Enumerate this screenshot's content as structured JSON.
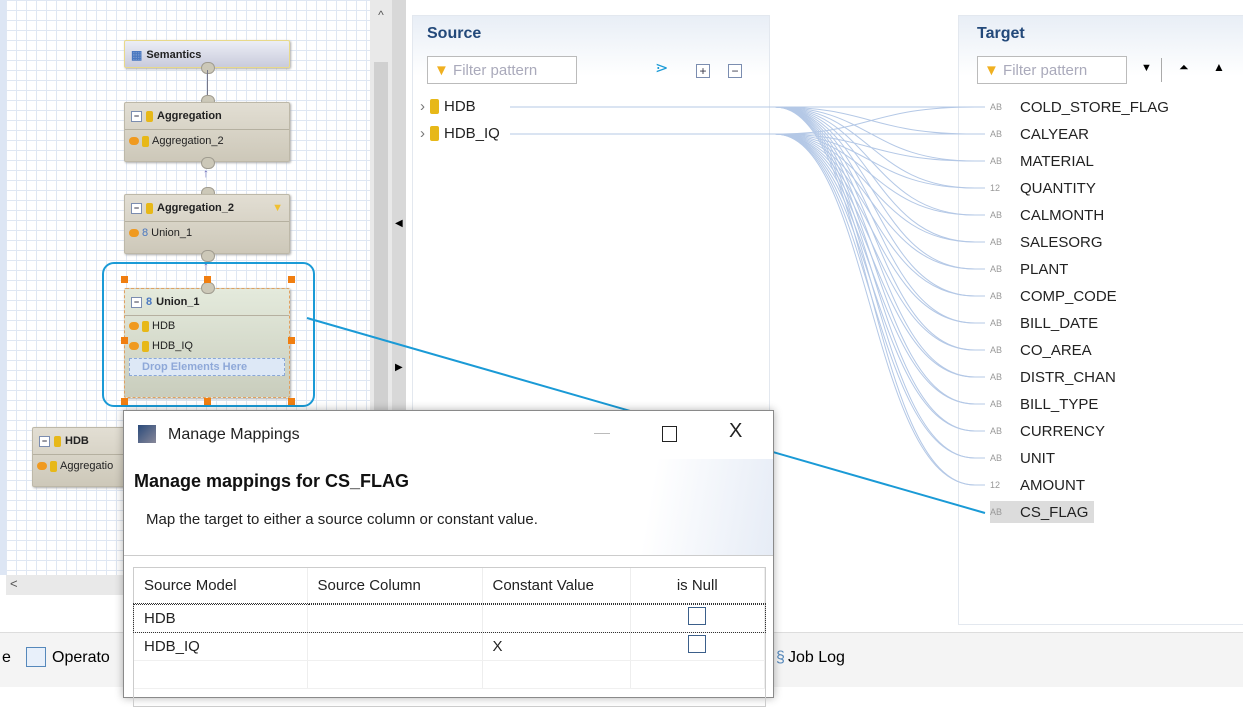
{
  "diagram": {
    "nodes": [
      {
        "title": "Semantics"
      },
      {
        "title": "Aggregation",
        "rows": [
          "Aggregation_2"
        ]
      },
      {
        "title": "Aggregation_2",
        "rows": [
          "Union_1"
        ]
      },
      {
        "title": "Union_1",
        "rows": [
          "HDB",
          "HDB_IQ"
        ],
        "drop": "Drop Elements Here"
      },
      {
        "title": "HDB",
        "rows": [
          "Aggregatio"
        ]
      }
    ]
  },
  "source": {
    "title": "Source",
    "filter_placeholder": "Filter pattern",
    "items": [
      "HDB",
      "HDB_IQ"
    ]
  },
  "target": {
    "title": "Target",
    "filter_placeholder": "Filter pattern",
    "items": [
      {
        "type": "AB",
        "name": "COLD_STORE_FLAG"
      },
      {
        "type": "AB",
        "name": "CALYEAR"
      },
      {
        "type": "AB",
        "name": "MATERIAL"
      },
      {
        "type": "12",
        "name": "QUANTITY"
      },
      {
        "type": "AB",
        "name": "CALMONTH"
      },
      {
        "type": "AB",
        "name": "SALESORG"
      },
      {
        "type": "AB",
        "name": "PLANT"
      },
      {
        "type": "AB",
        "name": "COMP_CODE"
      },
      {
        "type": "AB",
        "name": "BILL_DATE"
      },
      {
        "type": "AB",
        "name": "CO_AREA"
      },
      {
        "type": "AB",
        "name": "DISTR_CHAN"
      },
      {
        "type": "AB",
        "name": "BILL_TYPE"
      },
      {
        "type": "AB",
        "name": "CURRENCY"
      },
      {
        "type": "AB",
        "name": "UNIT"
      },
      {
        "type": "12",
        "name": "AMOUNT"
      },
      {
        "type": "AB",
        "name": "CS_FLAG",
        "selected": true
      }
    ]
  },
  "bottom_tabs": {
    "left_fragment": "e",
    "operator": "Operato",
    "job_log": "Job Log"
  },
  "dialog": {
    "title": "Manage Mappings",
    "heading": "Manage mappings for CS_FLAG",
    "description": "Map the target to either a source column or constant value.",
    "columns": [
      "Source Model",
      "Source Column",
      "Constant Value",
      "is Null"
    ],
    "rows": [
      {
        "model": "HDB",
        "column": "",
        "constant": "",
        "is_null": false
      },
      {
        "model": "HDB_IQ",
        "column": "",
        "constant": "X",
        "is_null": false
      }
    ],
    "close": "X"
  },
  "colors": {
    "accent": "#1a9ad6",
    "title_blue": "#23497a",
    "mapping_line": "#b4c8e6"
  }
}
